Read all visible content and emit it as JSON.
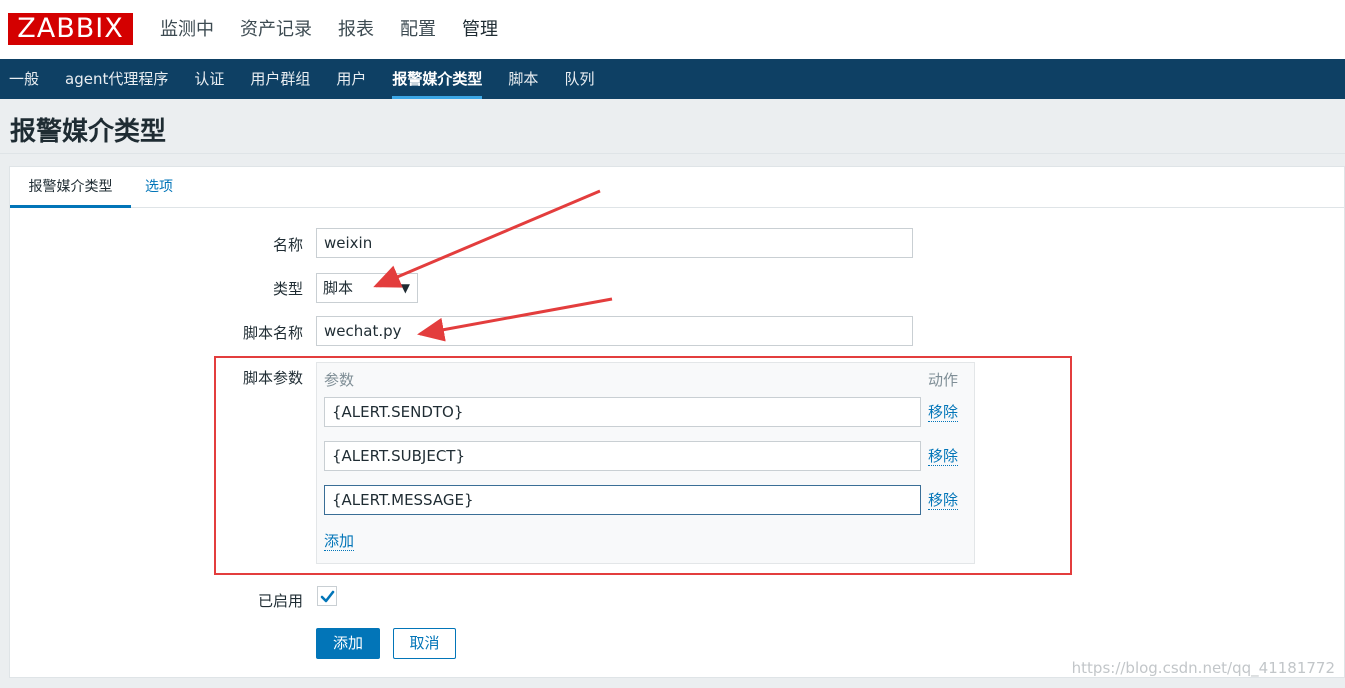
{
  "app": {
    "logo": "ZABBIX"
  },
  "top_nav": [
    {
      "label": "监测中"
    },
    {
      "label": "资产记录"
    },
    {
      "label": "报表"
    },
    {
      "label": "配置"
    },
    {
      "label": "管理"
    }
  ],
  "sub_nav": [
    {
      "label": "一般"
    },
    {
      "label": "agent代理程序"
    },
    {
      "label": "认证"
    },
    {
      "label": "用户群组"
    },
    {
      "label": "用户"
    },
    {
      "label": "报警媒介类型"
    },
    {
      "label": "脚本"
    },
    {
      "label": "队列"
    }
  ],
  "page_title": "报警媒介类型",
  "tabs": {
    "media_type": "报警媒介类型",
    "options": "选项"
  },
  "form": {
    "name_label": "名称",
    "name_value": "weixin",
    "type_label": "类型",
    "type_value": "脚本",
    "script_name_label": "脚本名称",
    "script_name_value": "wechat.py",
    "script_params_label": "脚本参数",
    "params_col_header": "参数",
    "action_col_header": "动作",
    "params": [
      {
        "value": "{ALERT.SENDTO}",
        "remove": "移除"
      },
      {
        "value": "{ALERT.SUBJECT}",
        "remove": "移除"
      },
      {
        "value": "{ALERT.MESSAGE}",
        "remove": "移除"
      }
    ],
    "add_param": "添加",
    "enabled_label": "已启用",
    "enabled": true,
    "submit": "添加",
    "cancel": "取消"
  },
  "watermark": "https://blog.csdn.net/qq_41181772",
  "colors": {
    "accent": "#0275b8",
    "subnav_bg": "#0e4064",
    "logo_bg": "#d40000",
    "annotation": "#e33d3d"
  }
}
